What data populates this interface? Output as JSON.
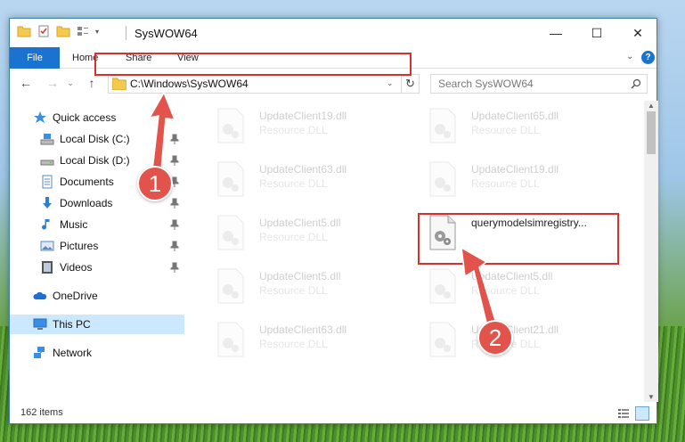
{
  "window": {
    "title": "SysWOW64",
    "controls": {
      "minimize": "—",
      "maximize": "☐",
      "close": "✕"
    }
  },
  "ribbon": {
    "file_label": "File",
    "tabs": [
      "Home",
      "Share",
      "View"
    ],
    "help": "?"
  },
  "navbar": {
    "address": "C:\\Windows\\SysWOW64",
    "search_placeholder": "Search SysWOW64"
  },
  "sidebar": {
    "items": [
      {
        "label": "Quick access",
        "icon": "star-icon",
        "pinned": false
      },
      {
        "label": "Local Disk (C:)",
        "icon": "disk-icon",
        "pinned": true
      },
      {
        "label": "Local Disk (D:)",
        "icon": "disk-icon",
        "pinned": true
      },
      {
        "label": "Documents",
        "icon": "documents-icon",
        "pinned": true
      },
      {
        "label": "Downloads",
        "icon": "downloads-icon",
        "pinned": true
      },
      {
        "label": "Music",
        "icon": "music-icon",
        "pinned": true
      },
      {
        "label": "Pictures",
        "icon": "pictures-icon",
        "pinned": true
      },
      {
        "label": "Videos",
        "icon": "videos-icon",
        "pinned": true
      },
      {
        "label": "OneDrive",
        "icon": "onedrive-icon",
        "pinned": false
      },
      {
        "label": "This PC",
        "icon": "computer-icon",
        "pinned": false,
        "selected": true
      },
      {
        "label": "Network",
        "icon": "network-icon",
        "pinned": false
      }
    ]
  },
  "files": [
    {
      "name": "UpdateClient19.dll",
      "desc": "Resource DLL"
    },
    {
      "name": "UpdateClient65.dll",
      "desc": "Resource DLL"
    },
    {
      "name": "UpdateClient63.dll",
      "desc": "Resource DLL"
    },
    {
      "name": "UpdateClient19.dll",
      "desc": "Resource DLL"
    },
    {
      "name": "UpdateClient5.dll",
      "desc": "Resource DLL"
    },
    {
      "name": "querymodelsimregistry...",
      "desc": ""
    },
    {
      "name": "UpdateClient5.dll",
      "desc": "Resource DLL"
    },
    {
      "name": "UpdateClient5.dll",
      "desc": "Resource DLL"
    },
    {
      "name": "UpdateClient63.dll",
      "desc": "Resource DLL"
    },
    {
      "name": "UpdateClient21.dll",
      "desc": "Resource DLL"
    }
  ],
  "status": {
    "item_count": "162 items"
  },
  "annotations": {
    "step1": "1",
    "step2": "2"
  },
  "colors": {
    "accent": "#1a73d0",
    "highlight": "#d9302c",
    "arrow": "#e2534c",
    "selection": "#cce8ff"
  }
}
